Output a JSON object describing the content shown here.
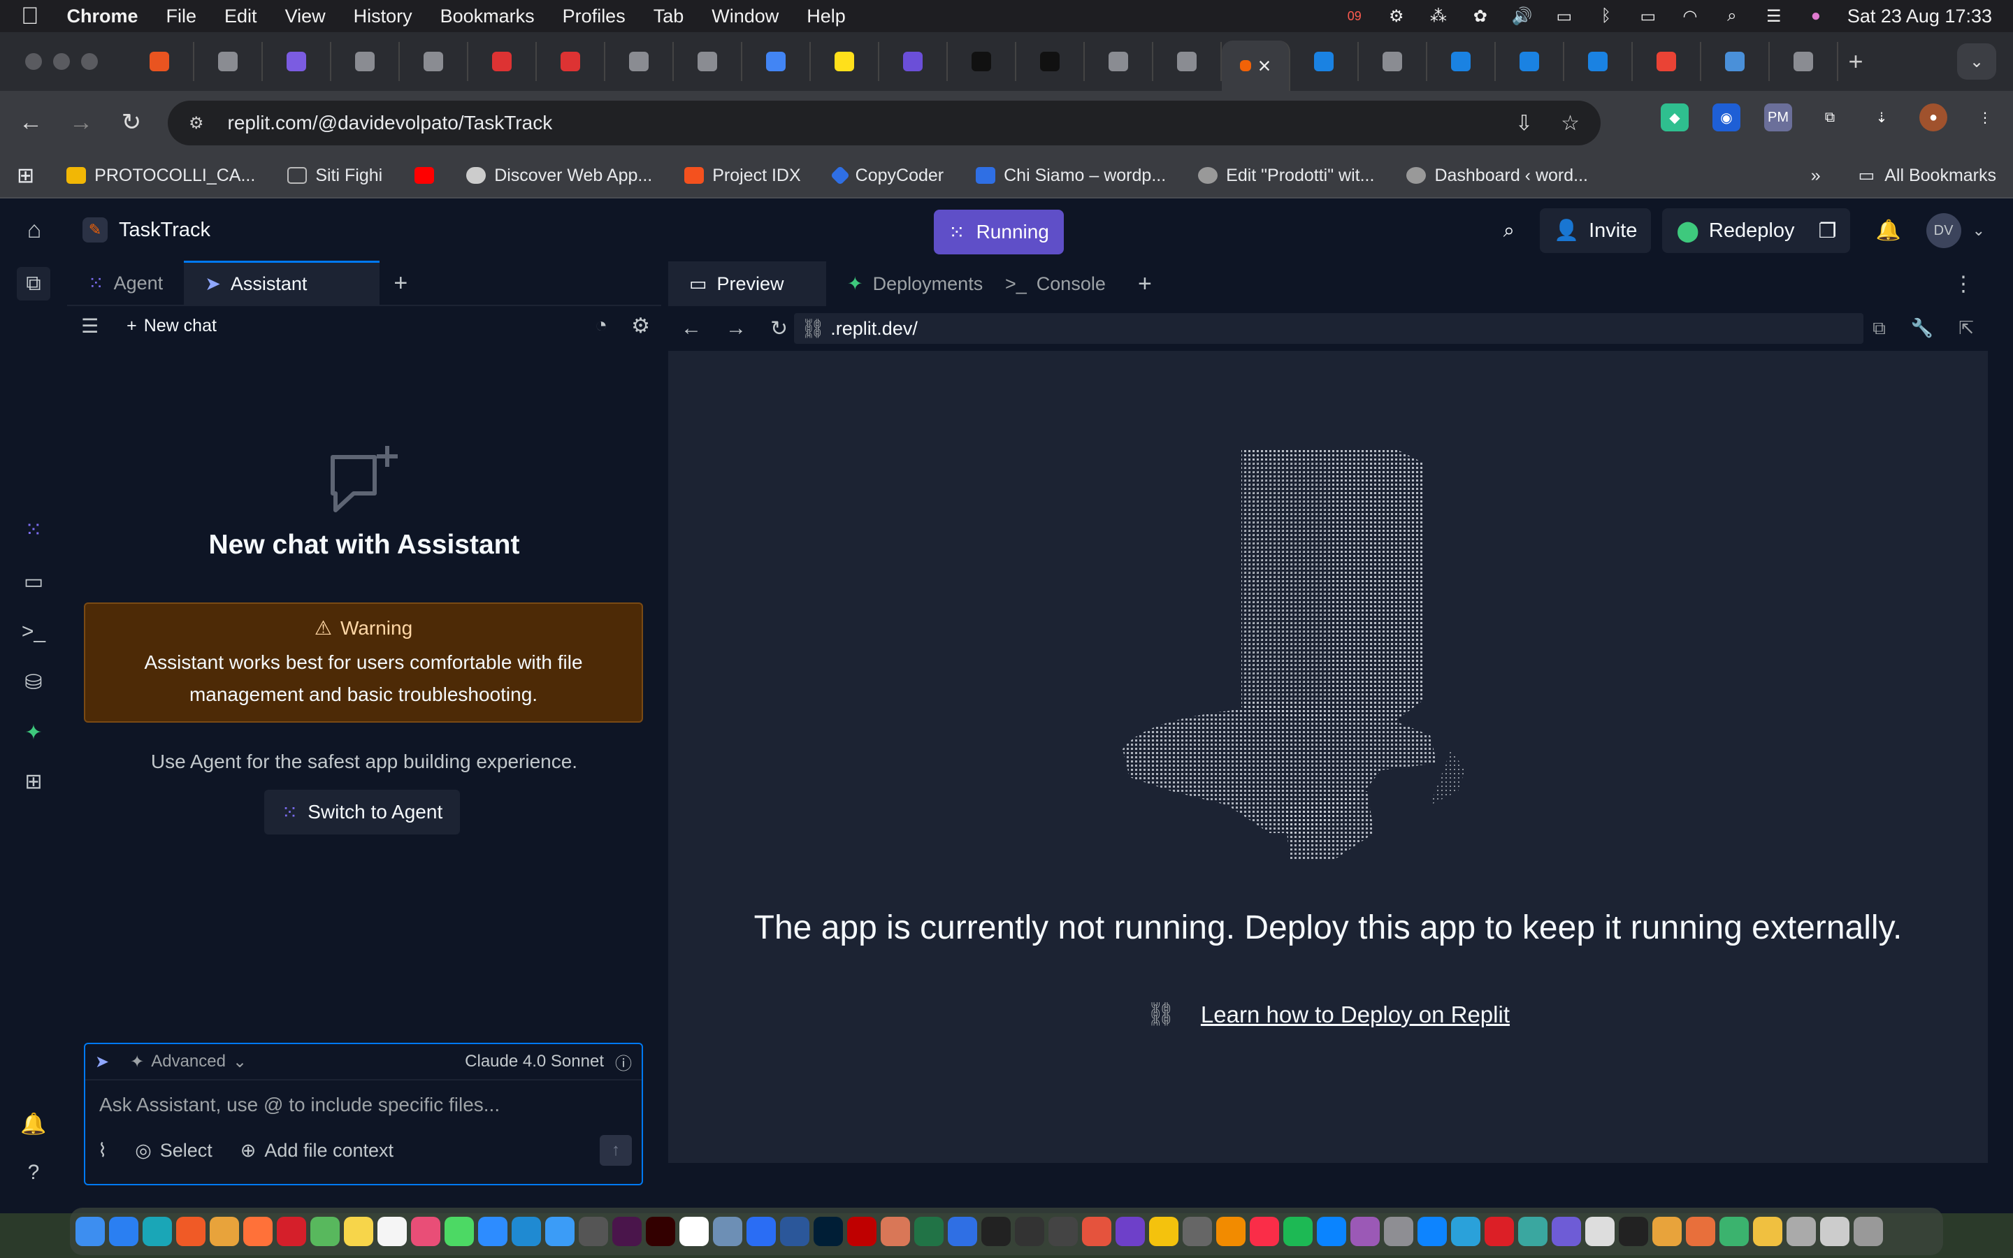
{
  "menubar": {
    "app": "Chrome",
    "items": [
      "File",
      "Edit",
      "View",
      "History",
      "Bookmarks",
      "Profiles",
      "Tab",
      "Window",
      "Help"
    ],
    "clock": "Sat 23 Aug  17:33",
    "badge": "09"
  },
  "browser": {
    "url": "replit.com/@davidevolpato/TaskTrack",
    "bookmarks": [
      {
        "label": "PROTOCOLLI_CA...",
        "color": "#f2b705"
      },
      {
        "label": "Siti Fighi",
        "color": "#777"
      },
      {
        "label": "",
        "color": "#ff0000"
      },
      {
        "label": "Discover Web App...",
        "color": "#bbb"
      },
      {
        "label": "Project IDX",
        "color": "#f4511e"
      },
      {
        "label": "CopyCoder",
        "color": "#2f6fe4"
      },
      {
        "label": "Chi Siamo – wordp...",
        "color": "#2f6fe4"
      },
      {
        "label": "Edit \"Prodotti\" wit...",
        "color": "#999"
      },
      {
        "label": "Dashboard ‹ word...",
        "color": "#999"
      }
    ],
    "all_bookmarks": "All Bookmarks",
    "active_tab_close": "×"
  },
  "replit": {
    "project": "TaskTrack",
    "run_label": "Running",
    "invite": "Invite",
    "redeploy": "Redeploy",
    "avatar": "DV",
    "left_tabs": [
      "Agent",
      "Assistant"
    ],
    "new_chat": "New chat",
    "empty_title": "New chat with Assistant",
    "warning_title": "Warning",
    "warning_body": "Assistant works best for users comfortable with file management and basic troubleshooting.",
    "use_agent": "Use Agent for the safest app building experience.",
    "switch_agent": "Switch to Agent",
    "composer": {
      "mode": "Advanced",
      "model": "Claude 4.0 Sonnet",
      "placeholder": "Ask Assistant, use @ to include specific files...",
      "select": "Select",
      "add_context": "Add file context"
    },
    "right_tabs": [
      "Preview",
      "Deployments",
      "Console"
    ],
    "preview_url": ".replit.dev/",
    "not_running": "The app is currently not running. Deploy this app to keep it running externally.",
    "learn_link": "Learn how to Deploy on Replit"
  },
  "colors": {
    "bg": "#0e1525",
    "surface": "#1c2333",
    "accent": "#0079f2",
    "running": "#5f4fc8",
    "warning_bg": "#4d2a06"
  }
}
